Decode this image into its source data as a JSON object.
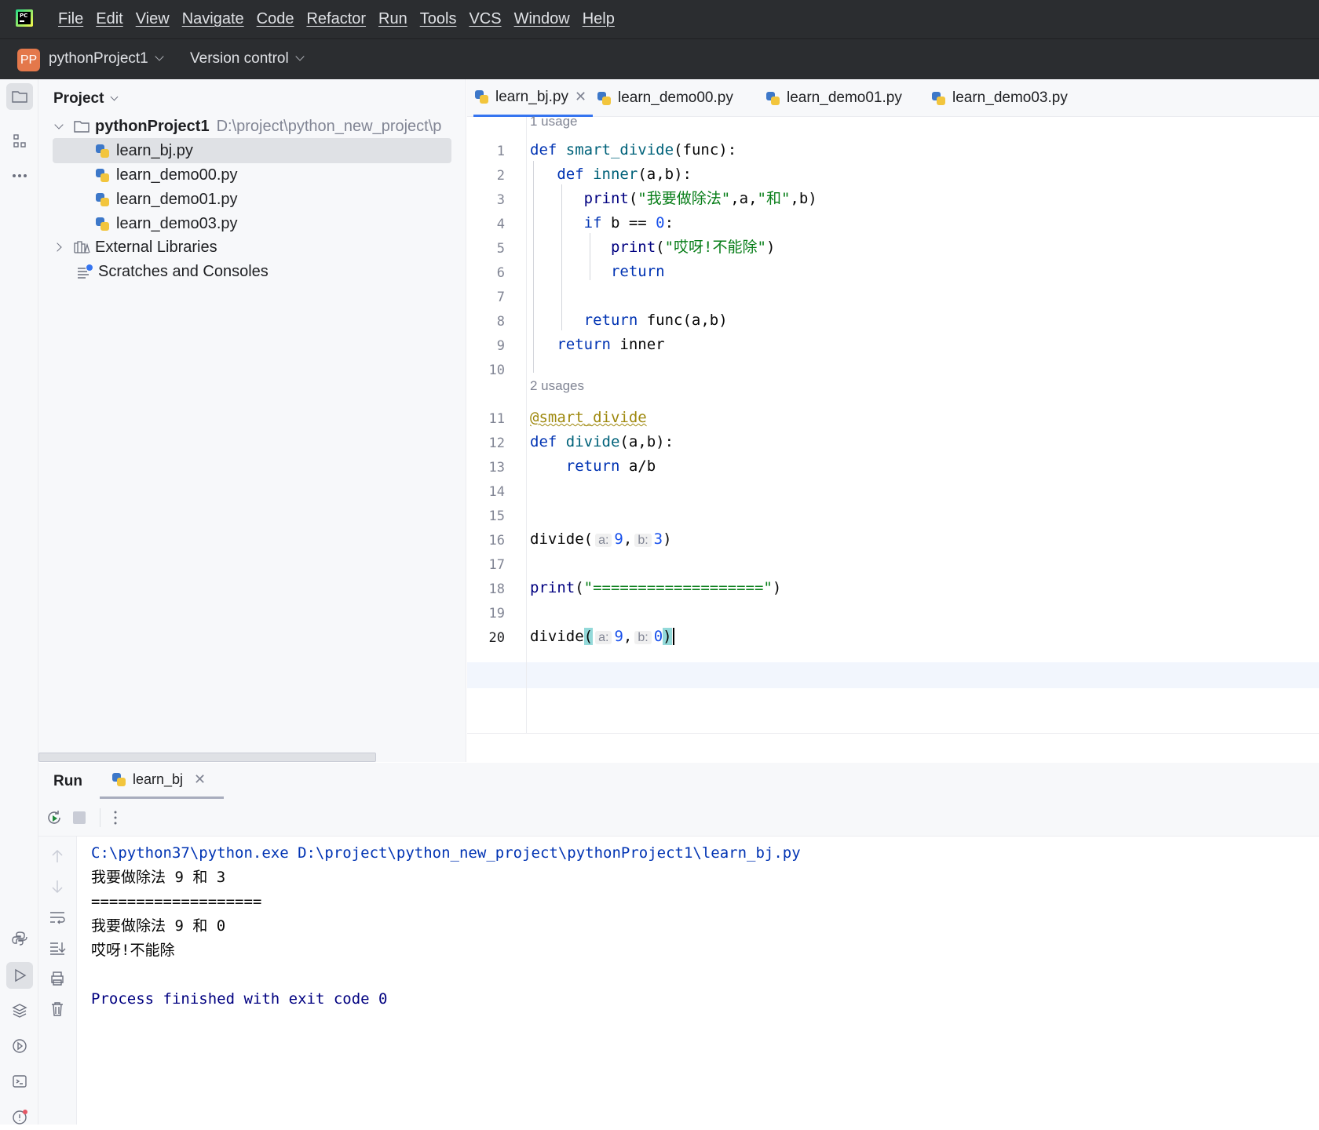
{
  "menubar": {
    "items": [
      "File",
      "Edit",
      "View",
      "Navigate",
      "Code",
      "Refactor",
      "Run",
      "Tools",
      "VCS",
      "Window",
      "Help"
    ],
    "logo_text": "PC"
  },
  "project_bar": {
    "badge": "PP",
    "project_name": "pythonProject1",
    "version_control": "Version control"
  },
  "project_panel": {
    "title": "Project",
    "root_name": "pythonProject1",
    "root_path": "D:\\project\\python_new_project\\p",
    "files": [
      "learn_bj.py",
      "learn_demo00.py",
      "learn_demo01.py",
      "learn_demo03.py"
    ],
    "external": "External Libraries",
    "scratches": "Scratches and Consoles"
  },
  "tabs": [
    "learn_bj.py",
    "learn_demo00.py",
    "learn_demo01.py",
    "learn_demo03.py"
  ],
  "editor": {
    "usage_1": "1 usage",
    "usage_2": "2 usages",
    "line_numbers": [
      "1",
      "2",
      "3",
      "4",
      "5",
      "6",
      "7",
      "8",
      "9",
      "10",
      "11",
      "12",
      "13",
      "14",
      "15",
      "16",
      "17",
      "18",
      "19",
      "20"
    ],
    "hint_a": "a:",
    "hint_b": "b:"
  },
  "run_panel": {
    "title": "Run",
    "tab": "learn_bj",
    "console": {
      "command": "C:\\python37\\python.exe D:\\project\\python_new_project\\pythonProject1\\learn_bj.py",
      "line1": "我要做除法 9 和 3",
      "line2": "===================",
      "line3": "我要做除法 9 和 0",
      "line4": "哎呀!不能除",
      "exit": "Process finished with exit code 0"
    }
  }
}
